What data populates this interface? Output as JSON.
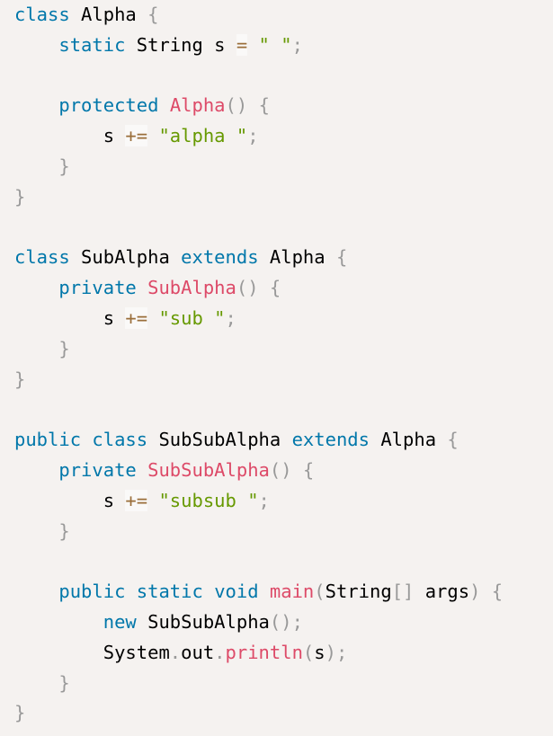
{
  "code_block": {
    "language": "java",
    "lines": [
      [
        {
          "t": "keyword",
          "v": "class"
        },
        {
          "t": "plain",
          "v": " Alpha "
        },
        {
          "t": "punctuation",
          "v": "{"
        }
      ],
      [
        {
          "t": "plain",
          "v": "    "
        },
        {
          "t": "keyword",
          "v": "static"
        },
        {
          "t": "plain",
          "v": " String s "
        },
        {
          "t": "operator",
          "v": "="
        },
        {
          "t": "plain",
          "v": " "
        },
        {
          "t": "string",
          "v": "\" \""
        },
        {
          "t": "punctuation",
          "v": ";"
        }
      ],
      [],
      [
        {
          "t": "plain",
          "v": "    "
        },
        {
          "t": "keyword",
          "v": "protected"
        },
        {
          "t": "plain",
          "v": " "
        },
        {
          "t": "function",
          "v": "Alpha"
        },
        {
          "t": "punctuation",
          "v": "()"
        },
        {
          "t": "plain",
          "v": " "
        },
        {
          "t": "punctuation",
          "v": "{"
        }
      ],
      [
        {
          "t": "plain",
          "v": "        s "
        },
        {
          "t": "operator",
          "v": "+="
        },
        {
          "t": "plain",
          "v": " "
        },
        {
          "t": "string",
          "v": "\"alpha \""
        },
        {
          "t": "punctuation",
          "v": ";"
        }
      ],
      [
        {
          "t": "plain",
          "v": "    "
        },
        {
          "t": "punctuation",
          "v": "}"
        }
      ],
      [
        {
          "t": "punctuation",
          "v": "}"
        }
      ],
      [],
      [
        {
          "t": "keyword",
          "v": "class"
        },
        {
          "t": "plain",
          "v": " SubAlpha "
        },
        {
          "t": "keyword",
          "v": "extends"
        },
        {
          "t": "plain",
          "v": " Alpha "
        },
        {
          "t": "punctuation",
          "v": "{"
        }
      ],
      [
        {
          "t": "plain",
          "v": "    "
        },
        {
          "t": "keyword",
          "v": "private"
        },
        {
          "t": "plain",
          "v": " "
        },
        {
          "t": "function",
          "v": "SubAlpha"
        },
        {
          "t": "punctuation",
          "v": "()"
        },
        {
          "t": "plain",
          "v": " "
        },
        {
          "t": "punctuation",
          "v": "{"
        }
      ],
      [
        {
          "t": "plain",
          "v": "        s "
        },
        {
          "t": "operator",
          "v": "+="
        },
        {
          "t": "plain",
          "v": " "
        },
        {
          "t": "string",
          "v": "\"sub \""
        },
        {
          "t": "punctuation",
          "v": ";"
        }
      ],
      [
        {
          "t": "plain",
          "v": "    "
        },
        {
          "t": "punctuation",
          "v": "}"
        }
      ],
      [
        {
          "t": "punctuation",
          "v": "}"
        }
      ],
      [],
      [
        {
          "t": "keyword",
          "v": "public"
        },
        {
          "t": "plain",
          "v": " "
        },
        {
          "t": "keyword",
          "v": "class"
        },
        {
          "t": "plain",
          "v": " SubSubAlpha "
        },
        {
          "t": "keyword",
          "v": "extends"
        },
        {
          "t": "plain",
          "v": " Alpha "
        },
        {
          "t": "punctuation",
          "v": "{"
        }
      ],
      [
        {
          "t": "plain",
          "v": "    "
        },
        {
          "t": "keyword",
          "v": "private"
        },
        {
          "t": "plain",
          "v": " "
        },
        {
          "t": "function",
          "v": "SubSubAlpha"
        },
        {
          "t": "punctuation",
          "v": "()"
        },
        {
          "t": "plain",
          "v": " "
        },
        {
          "t": "punctuation",
          "v": "{"
        }
      ],
      [
        {
          "t": "plain",
          "v": "        s "
        },
        {
          "t": "operator",
          "v": "+="
        },
        {
          "t": "plain",
          "v": " "
        },
        {
          "t": "string",
          "v": "\"subsub \""
        },
        {
          "t": "punctuation",
          "v": ";"
        }
      ],
      [
        {
          "t": "plain",
          "v": "    "
        },
        {
          "t": "punctuation",
          "v": "}"
        }
      ],
      [],
      [
        {
          "t": "plain",
          "v": "    "
        },
        {
          "t": "keyword",
          "v": "public"
        },
        {
          "t": "plain",
          "v": " "
        },
        {
          "t": "keyword",
          "v": "static"
        },
        {
          "t": "plain",
          "v": " "
        },
        {
          "t": "keyword",
          "v": "void"
        },
        {
          "t": "plain",
          "v": " "
        },
        {
          "t": "function",
          "v": "main"
        },
        {
          "t": "punctuation",
          "v": "("
        },
        {
          "t": "plain",
          "v": "String"
        },
        {
          "t": "punctuation",
          "v": "[]"
        },
        {
          "t": "plain",
          "v": " args"
        },
        {
          "t": "punctuation",
          "v": ")"
        },
        {
          "t": "plain",
          "v": " "
        },
        {
          "t": "punctuation",
          "v": "{"
        }
      ],
      [
        {
          "t": "plain",
          "v": "        "
        },
        {
          "t": "keyword",
          "v": "new"
        },
        {
          "t": "plain",
          "v": " "
        },
        {
          "t": "plain",
          "v": "SubSubAlpha"
        },
        {
          "t": "punctuation",
          "v": "();"
        }
      ],
      [
        {
          "t": "plain",
          "v": "        System"
        },
        {
          "t": "punctuation",
          "v": "."
        },
        {
          "t": "plain",
          "v": "out"
        },
        {
          "t": "punctuation",
          "v": "."
        },
        {
          "t": "function",
          "v": "println"
        },
        {
          "t": "punctuation",
          "v": "("
        },
        {
          "t": "plain",
          "v": "s"
        },
        {
          "t": "punctuation",
          "v": ");"
        }
      ],
      [
        {
          "t": "plain",
          "v": "    "
        },
        {
          "t": "punctuation",
          "v": "}"
        }
      ],
      [
        {
          "t": "punctuation",
          "v": "}"
        }
      ]
    ]
  },
  "colors": {
    "background": "#f5f2f0",
    "keyword": "#0077aa",
    "function": "#dd4a68",
    "string": "#669900",
    "operator": "#9a6e3a",
    "punctuation": "#999999",
    "plain": "#000000"
  }
}
